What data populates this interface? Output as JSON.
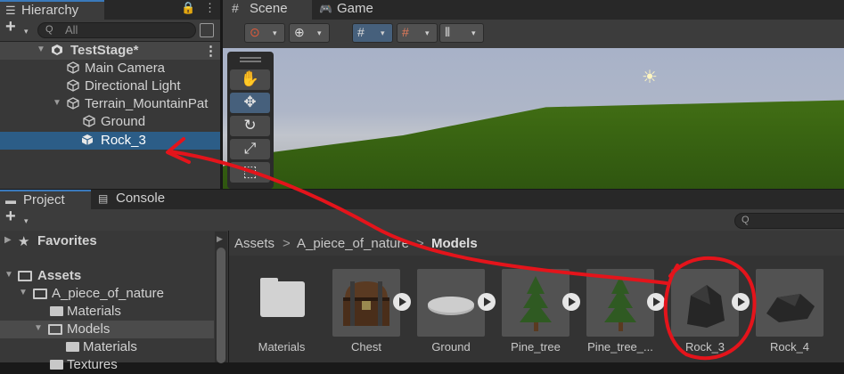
{
  "hierarchy": {
    "tab_label": "Hierarchy",
    "tab_icon": "list-icon",
    "lock_glyph": "🔒",
    "menu_glyph": "⋮",
    "add_glyph": "+",
    "dropdown_glyph": "▾",
    "search_placeholder": "All",
    "search_glyph": "Q",
    "tree": {
      "scene_name": "TestStage*",
      "items": [
        {
          "label": "Main Camera"
        },
        {
          "label": "Directional Light"
        },
        {
          "label": "Terrain_MountainPat"
        },
        {
          "label": "Ground"
        },
        {
          "label": "Rock_3"
        }
      ],
      "collapse_glyph": "▼",
      "expand_glyph": "▶",
      "scene_menu_glyph": "⋮"
    }
  },
  "scene": {
    "tabs": [
      {
        "label": "Scene",
        "icon": "grid-icon",
        "glyph": "#"
      },
      {
        "label": "Game",
        "icon": "gamepad-icon",
        "glyph": "🎮"
      }
    ],
    "toolbar_glyphs": {
      "gizmo": "⊙",
      "global": "⊕",
      "grid": "#",
      "snap": "#",
      "increment": "⦀",
      "dropdown": "▾"
    },
    "tools": [
      {
        "name": "hand",
        "glyph": "✋"
      },
      {
        "name": "move",
        "glyph": "✥"
      },
      {
        "name": "rotate",
        "glyph": "↻"
      },
      {
        "name": "scale",
        "glyph": "⤢"
      },
      {
        "name": "rect",
        "glyph": "⬚"
      }
    ],
    "sun_glyph": "☀"
  },
  "project": {
    "tabs": [
      {
        "label": "Project",
        "icon": "folder-icon",
        "glyph": "▬"
      },
      {
        "label": "Console",
        "icon": "console-icon",
        "glyph": "▤"
      }
    ],
    "add_glyph": "+",
    "search_glyph": "Q",
    "tree": {
      "favorites": "Favorites",
      "assets": "Assets",
      "nature": "A_piece_of_nature",
      "materials": "Materials",
      "models": "Models",
      "models_materials": "Materials",
      "textures": "Textures",
      "star_glyph": "★"
    },
    "breadcrumb": [
      "Assets",
      "A_piece_of_nature",
      "Models"
    ],
    "breadcrumb_sep": ">",
    "assets": [
      {
        "name": "Materials",
        "kind": "folder"
      },
      {
        "name": "Chest",
        "kind": "model"
      },
      {
        "name": "Ground",
        "kind": "model"
      },
      {
        "name": "Pine_tree",
        "kind": "model"
      },
      {
        "name": "Pine_tree_...",
        "kind": "model"
      },
      {
        "name": "Rock_3",
        "kind": "model"
      },
      {
        "name": "Rock_4",
        "kind": "model"
      }
    ]
  },
  "colors": {
    "selection": "#2c5d87",
    "annotation": "#e4141b",
    "grass": "#3a6512"
  }
}
